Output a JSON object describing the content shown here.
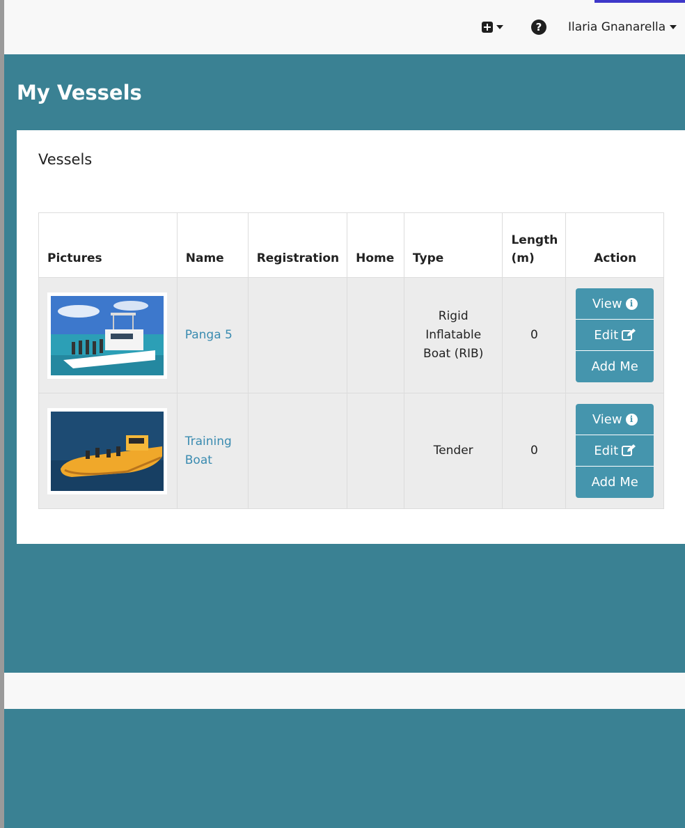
{
  "topbar": {
    "add_icon": "plus-square-icon",
    "help_icon": "question-circle-icon",
    "help_glyph": "?",
    "user_name": "Ilaria Gnanarella"
  },
  "page": {
    "title": "My Vessels"
  },
  "panel": {
    "title": "Vessels"
  },
  "table": {
    "headers": {
      "pictures": "Pictures",
      "name": "Name",
      "registration": "Registration",
      "home": "Home",
      "type": "Type",
      "length": "Length (m)",
      "action": "Action"
    },
    "rows": [
      {
        "picture": "boat-photo-white-cabin-cruiser",
        "name": "Panga 5",
        "registration": "",
        "home": "",
        "type": "Rigid Inflatable Boat (RIB)",
        "length": "0",
        "actions": {
          "view": "View",
          "edit": "Edit",
          "add": "Add Me"
        }
      },
      {
        "picture": "boat-photo-yellow-rib",
        "name": "Training Boat",
        "registration": "",
        "home": "",
        "type": "Tender",
        "length": "0",
        "actions": {
          "view": "View",
          "edit": "Edit",
          "add": "Add Me"
        }
      }
    ]
  },
  "colors": {
    "brand_teal": "#3a8193",
    "button": "#4595ad",
    "link": "#3a8bb0",
    "row_bg": "#ececec"
  },
  "icons": {
    "view": "info-circle-icon",
    "view_glyph": "i",
    "edit": "edit-square-icon"
  }
}
